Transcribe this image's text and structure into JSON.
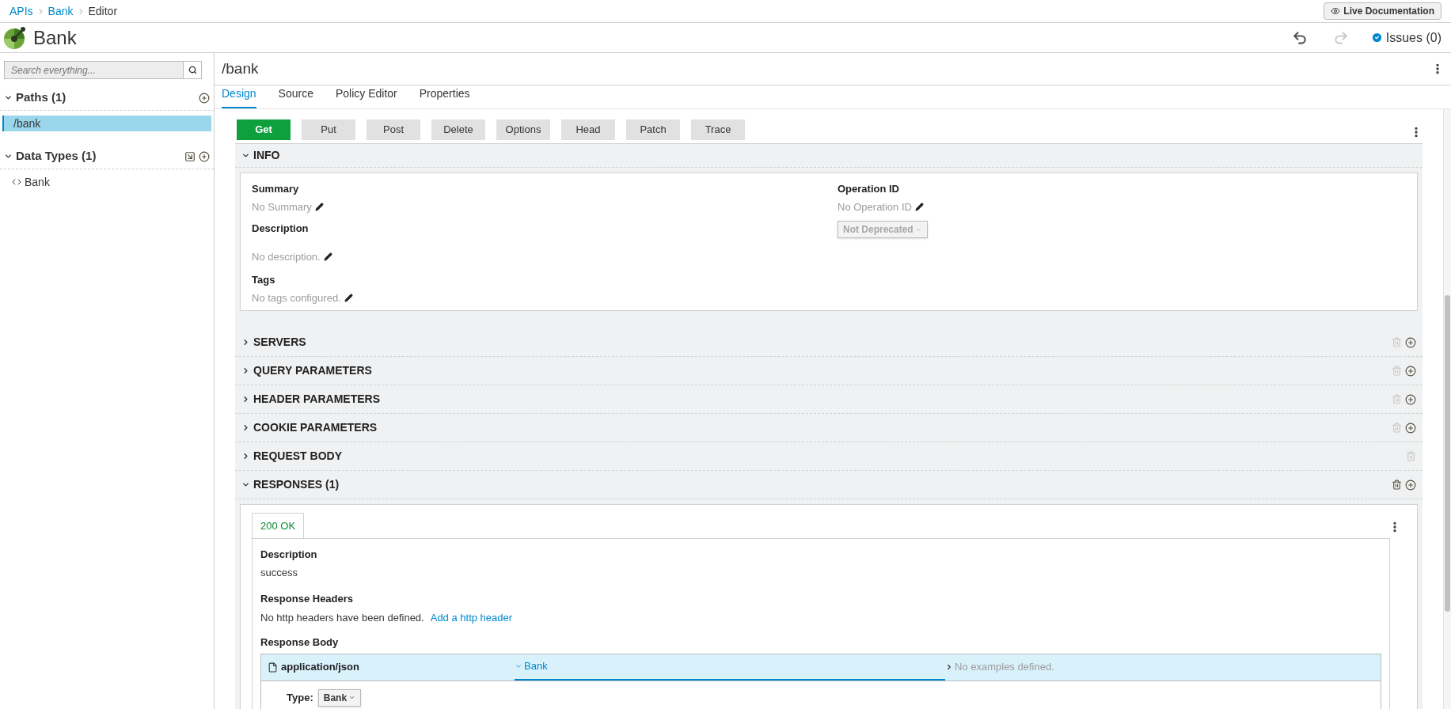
{
  "breadcrumbs": [
    {
      "label": "APIs",
      "link": true
    },
    {
      "label": "Bank",
      "link": true
    },
    {
      "label": "Editor",
      "link": false
    }
  ],
  "live_doc_button": "Live Documentation",
  "api_title": "Bank",
  "undo_enabled": true,
  "redo_enabled": false,
  "issues": "Issues (0)",
  "search": {
    "placeholder": "Search everything..."
  },
  "sidebar": [
    {
      "title": "Paths (1)",
      "expanded": true,
      "can_import": false,
      "items": [
        {
          "label": "/bank",
          "kind": "path",
          "selected": true
        }
      ]
    },
    {
      "title": "Data Types (1)",
      "expanded": true,
      "can_import": true,
      "items": [
        {
          "label": "Bank",
          "kind": "type",
          "selected": false
        }
      ]
    }
  ],
  "path_title": "/bank",
  "tabs": [
    {
      "label": "Design",
      "selected": true
    },
    {
      "label": "Source",
      "selected": false
    },
    {
      "label": "Policy Editor",
      "selected": false
    },
    {
      "label": "Properties",
      "selected": false
    }
  ],
  "methods": [
    {
      "label": "Get",
      "selected": true
    },
    {
      "label": "Put",
      "selected": false
    },
    {
      "label": "Post",
      "selected": false
    },
    {
      "label": "Delete",
      "selected": false
    },
    {
      "label": "Options",
      "selected": false
    },
    {
      "label": "Head",
      "selected": false
    },
    {
      "label": "Patch",
      "selected": false
    },
    {
      "label": "Trace",
      "selected": false
    }
  ],
  "info": {
    "title": "INFO",
    "expanded": true,
    "left": [
      {
        "label": "Summary",
        "value": "No Summary"
      },
      {
        "label": "Description",
        "value": "No description."
      },
      {
        "label": "Tags",
        "value": "No tags configured."
      }
    ],
    "operation_id": {
      "label": "Operation ID",
      "value": "No Operation ID"
    },
    "deprecated_select": "Not Deprecated"
  },
  "sections": [
    {
      "title": "SERVERS",
      "expanded": false,
      "delete_enabled": false,
      "can_add": true
    },
    {
      "title": "QUERY PARAMETERS",
      "expanded": false,
      "delete_enabled": false,
      "can_add": true
    },
    {
      "title": "HEADER PARAMETERS",
      "expanded": false,
      "delete_enabled": false,
      "can_add": true
    },
    {
      "title": "COOKIE PARAMETERS",
      "expanded": false,
      "delete_enabled": false,
      "can_add": true
    },
    {
      "title": "REQUEST BODY",
      "expanded": false,
      "delete_enabled": false,
      "can_add": false
    },
    {
      "title": "RESPONSES (1)",
      "expanded": true,
      "delete_enabled": true,
      "can_add": true
    }
  ],
  "responses": {
    "tabs": [
      {
        "label": "200 OK",
        "selected": true
      }
    ],
    "description_label": "Description",
    "description": "success",
    "headers_label": "Response Headers",
    "headers_text": "No http headers have been defined.",
    "headers_link": "Add a http header",
    "body_label": "Response Body",
    "media": {
      "type": "application/json",
      "schema": "Bank",
      "schema_expanded": true,
      "examples": "No examples defined.",
      "type_label": "Type:",
      "type_value": "Bank"
    }
  }
}
